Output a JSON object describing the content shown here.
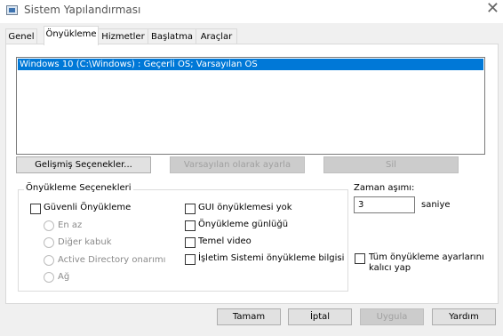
{
  "window": {
    "title": "Sistem Yapılandırması"
  },
  "tabs": [
    "Genel",
    "Önyükleme",
    "Hizmetler",
    "Başlatma",
    "Araçlar"
  ],
  "os_list": {
    "items": [
      "Windows 10 (C:\\Windows) : Geçerli OS; Varsayılan OS"
    ]
  },
  "list_buttons": {
    "advanced": "Gelişmiş Seçenekler...",
    "set_default": "Varsayılan olarak ayarla",
    "delete": "Sil"
  },
  "boot_options": {
    "title": "Önyükleme Seçenekleri",
    "safe_boot": "Güvenli Önyükleme",
    "minimal": "En az",
    "alternate_shell": "Diğer kabuk",
    "ad_repair": "Active Directory onarımı",
    "network": "Ağ",
    "no_gui_boot": "GUI önyüklemesi yok",
    "boot_log": "Önyükleme günlüğü",
    "base_video": "Temel video",
    "os_boot_info": "İşletim Sistemi önyükleme bilgisi"
  },
  "timeout": {
    "label": "Zaman aşımı:",
    "value": "3",
    "unit": "saniye"
  },
  "make_permanent": {
    "line1": "Tüm önyükleme ayarlarını",
    "line2": "kalıcı yap"
  },
  "footer": {
    "ok": "Tamam",
    "cancel": "İptal",
    "apply": "Uygula",
    "help": "Yardım"
  }
}
